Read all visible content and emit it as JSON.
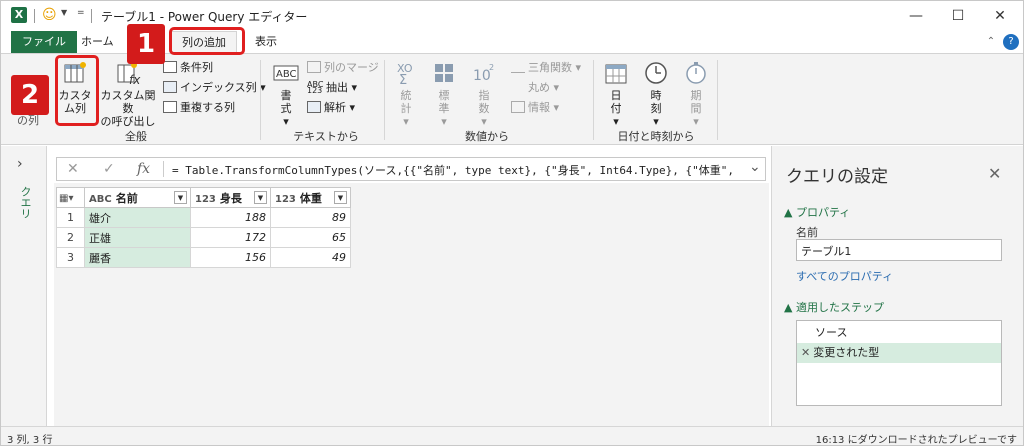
{
  "window": {
    "app_icon": "X",
    "quick_access": [
      "smiley-icon",
      "customize-arrow-icon"
    ],
    "title": "テーブル1 - Power Query エディター",
    "controls": {
      "minimize": "—",
      "maximize": "☐",
      "close": "✕"
    }
  },
  "tabs": [
    {
      "label": "ファイル",
      "id": "file"
    },
    {
      "label": "ホーム",
      "id": "home"
    },
    {
      "label": "列の追加",
      "id": "add-column",
      "active": true
    },
    {
      "label": "表示",
      "id": "view"
    }
  ],
  "ribbon": {
    "general": {
      "group_label": "全般",
      "partial_label": "の列",
      "custom_column": "カスタム列",
      "custom_function": [
        "カスタム関数",
        "の呼び出し"
      ],
      "conditional_column": "条件列",
      "index_column": "インデックス列 ▾",
      "duplicate_column": "重複する列"
    },
    "text": {
      "group_label": "テキストから",
      "format": "書式 ▾",
      "merge_columns": "列のマージ",
      "extract": "抽出 ▾",
      "parse": "解析 ▾"
    },
    "number": {
      "group_label": "数値から",
      "statistics": "統計 ▾",
      "standard": "標準 ▾",
      "scientific": "指数 ▾",
      "trigonometry": "三角関数 ▾",
      "rounding": "丸め ▾",
      "information": "情報 ▾"
    },
    "datetime": {
      "group_label": "日付と時刻から",
      "date": "日付 ▾",
      "time": "時刻 ▾",
      "duration": "期間 ▾"
    }
  },
  "callouts": [
    "1",
    "2"
  ],
  "left_pane": {
    "arrow": "›",
    "label": "クエリ"
  },
  "formula_bar": {
    "cancel": "✕",
    "confirm": "✓",
    "fx": "fx",
    "formula": "= Table.TransformColumnTypes(ソース,{{\"名前\", type text}, {\"身長\", Int64.Type}, {\"体重\",",
    "expand": "⌄"
  },
  "grid": {
    "columns": [
      {
        "type": "ABC",
        "name": "名前"
      },
      {
        "type": "123",
        "name": "身長"
      },
      {
        "type": "123",
        "name": "体重"
      }
    ],
    "rows": [
      {
        "n": "1",
        "name": "雄介",
        "height": "188",
        "weight": "89"
      },
      {
        "n": "2",
        "name": "正雄",
        "height": "172",
        "weight": "65"
      },
      {
        "n": "3",
        "name": "麗香",
        "height": "156",
        "weight": "49"
      }
    ]
  },
  "query_settings": {
    "title": "クエリの設定",
    "close": "✕",
    "properties_label": "▲ プロパティ",
    "name_label": "名前",
    "name_value": "テーブル1",
    "all_properties": "すべてのプロパティ",
    "steps_label": "▲ 適用したステップ",
    "steps": [
      {
        "label": "ソース",
        "active": false
      },
      {
        "label": "変更された型",
        "active": true
      }
    ],
    "step_delete_icon": "✕"
  },
  "status": {
    "left": "3 列, 3 行",
    "right": "16:13 にダウンロードされたプレビューです"
  }
}
